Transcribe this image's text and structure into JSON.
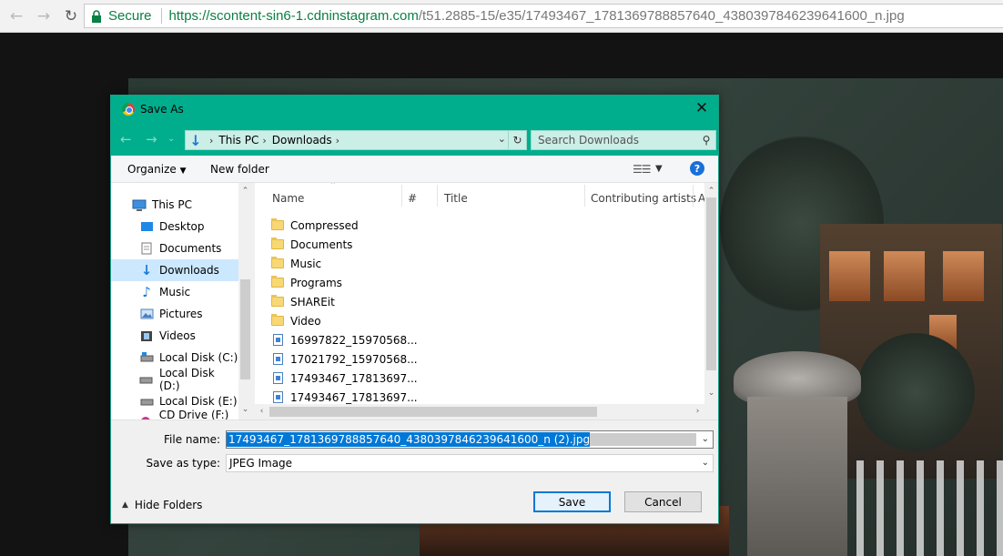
{
  "browser": {
    "secure_label": "Secure",
    "url_host": "https://scontent-sin6-1.cdninstagram.com",
    "url_path": "/t51.2885-15/e35/17493467_1781369788857640_4380397846239641600_n.jpg"
  },
  "dialog": {
    "title": "Save As",
    "breadcrumb": [
      "This PC",
      "Downloads"
    ],
    "search_placeholder": "Search Downloads",
    "toolbar": {
      "organize": "Organize",
      "new_folder": "New folder"
    },
    "nav_items": [
      {
        "label": "This PC",
        "icon": "computer-icon"
      },
      {
        "label": "Desktop",
        "icon": "desktop-icon"
      },
      {
        "label": "Documents",
        "icon": "documents-icon"
      },
      {
        "label": "Downloads",
        "icon": "download-arrow-icon",
        "selected": true
      },
      {
        "label": "Music",
        "icon": "music-note-icon"
      },
      {
        "label": "Pictures",
        "icon": "pictures-icon"
      },
      {
        "label": "Videos",
        "icon": "film-icon"
      },
      {
        "label": "Local Disk (C:)",
        "icon": "windows-drive-icon"
      },
      {
        "label": "Local Disk (D:)",
        "icon": "drive-icon"
      },
      {
        "label": "Local Disk (E:)",
        "icon": "drive-icon"
      },
      {
        "label": "CD Drive (F:) C",
        "icon": "cd-drive-icon"
      }
    ],
    "columns": [
      "Name",
      "#",
      "Title",
      "Contributing artists",
      "A"
    ],
    "files": [
      {
        "name": "Compressed",
        "type": "folder"
      },
      {
        "name": "Documents",
        "type": "folder"
      },
      {
        "name": "Music",
        "type": "folder"
      },
      {
        "name": "Programs",
        "type": "folder"
      },
      {
        "name": "SHAREit",
        "type": "folder"
      },
      {
        "name": "Video",
        "type": "folder"
      },
      {
        "name": "16997822_15970568...",
        "type": "image"
      },
      {
        "name": "17021792_15970568...",
        "type": "image"
      },
      {
        "name": "17493467_17813697...",
        "type": "image"
      },
      {
        "name": "17493467_17813697...",
        "type": "image"
      }
    ],
    "file_name_label": "File name:",
    "file_name_value": "17493467_1781369788857640_4380397846239641600_n (2).jpg",
    "save_type_label": "Save as type:",
    "save_type_value": "JPEG Image",
    "hide_folders": "Hide Folders",
    "save_button": "Save",
    "cancel_button": "Cancel"
  },
  "colors": {
    "titlebar": "#00ae8d",
    "selection": "#0078d7",
    "secure_green": "#0b8043"
  }
}
